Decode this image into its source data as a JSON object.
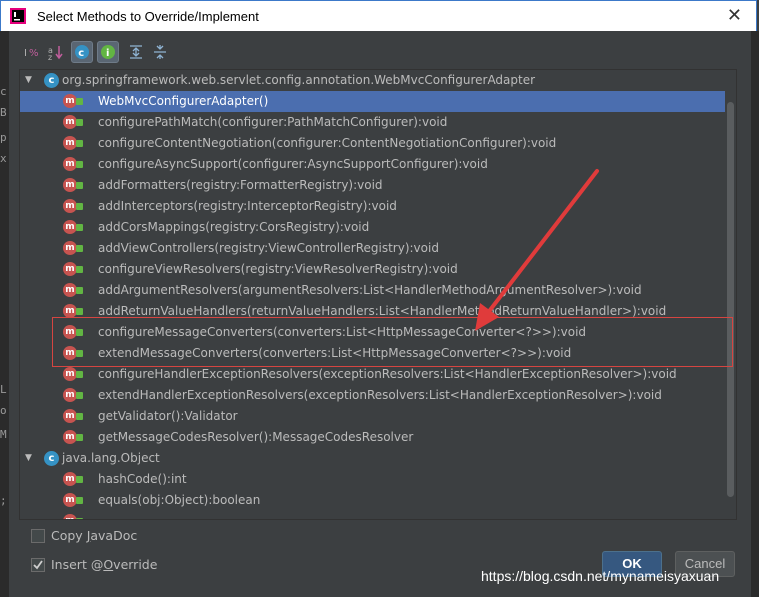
{
  "window": {
    "title": "Select Methods to Override/Implement",
    "close_glyph": "✕"
  },
  "left_strip_chars": [
    "c",
    "B",
    "p",
    "x",
    "L",
    "o",
    "M",
    ";"
  ],
  "toolbar": {
    "buttons": [
      {
        "name": "sort-by-visibility-icon",
        "on": false
      },
      {
        "name": "sort-alphabetically-icon",
        "on": false
      },
      {
        "name": "show-classes-icon",
        "on": true
      },
      {
        "name": "show-interfaces-icon",
        "on": true
      },
      {
        "name": "expand-all-icon",
        "on": false
      },
      {
        "name": "collapse-all-icon",
        "on": false
      }
    ]
  },
  "tree": {
    "group1": {
      "label": "org.springframework.web.servlet.config.annotation.WebMvcConfigurerAdapter",
      "badge": "c"
    },
    "group1_methods": [
      "WebMvcConfigurerAdapter()",
      "configurePathMatch(configurer:PathMatchConfigurer):void",
      "configureContentNegotiation(configurer:ContentNegotiationConfigurer):void",
      "configureAsyncSupport(configurer:AsyncSupportConfigurer):void",
      "addFormatters(registry:FormatterRegistry):void",
      "addInterceptors(registry:InterceptorRegistry):void",
      "addCorsMappings(registry:CorsRegistry):void",
      "addViewControllers(registry:ViewControllerRegistry):void",
      "configureViewResolvers(registry:ViewResolverRegistry):void",
      "addArgumentResolvers(argumentResolvers:List<HandlerMethodArgumentResolver>):void",
      "addReturnValueHandlers(returnValueHandlers:List<HandlerMethodReturnValueHandler>):void",
      "configureMessageConverters(converters:List<HttpMessageConverter<?>>):void",
      "extendMessageConverters(converters:List<HttpMessageConverter<?>>):void",
      "configureHandlerExceptionResolvers(exceptionResolvers:List<HandlerExceptionResolver>):void",
      "extendHandlerExceptionResolvers(exceptionResolvers:List<HandlerExceptionResolver>):void",
      "getValidator():Validator",
      "getMessageCodesResolver():MessageCodesResolver"
    ],
    "selected_index": 0,
    "group2": {
      "label": "java.lang.Object",
      "badge": "c"
    },
    "group2_methods": [
      "hashCode():int",
      "equals(obj:Object):boolean"
    ],
    "method_badge": "m"
  },
  "options": {
    "copy_javadoc": {
      "label_pre": "Copy ",
      "label_u": "J",
      "label_post": "avaDoc",
      "checked": false
    },
    "insert_override": {
      "label_pre": "Insert @",
      "label_u": "O",
      "label_post": "verride",
      "checked": true
    }
  },
  "buttons": {
    "ok": "OK",
    "cancel": "Cancel"
  },
  "watermark": "https://blog.csdn.net/mynameisyaxuan",
  "colors": {
    "selection": "#4b6eaf",
    "highlight_box": "#d64541",
    "annotation_arrow": "#e03b3b"
  }
}
